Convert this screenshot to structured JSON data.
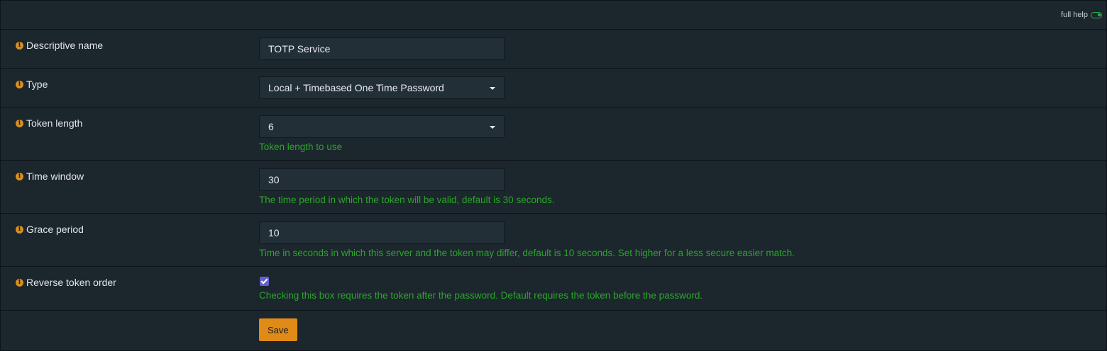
{
  "topbar": {
    "full_help_label": "full help"
  },
  "fields": {
    "descriptive_name": {
      "label": "Descriptive name",
      "value": "TOTP Service"
    },
    "type": {
      "label": "Type",
      "value": "Local + Timebased One Time Password"
    },
    "token_length": {
      "label": "Token length",
      "value": "6",
      "help": "Token length to use"
    },
    "time_window": {
      "label": "Time window",
      "value": "30",
      "help": "The time period in which the token will be valid, default is 30 seconds."
    },
    "grace_period": {
      "label": "Grace period",
      "value": "10",
      "help": "Time in seconds in which this server and the token may differ, default is 10 seconds. Set higher for a less secure easier match."
    },
    "reverse_token_order": {
      "label": "Reverse token order",
      "checked": true,
      "help": "Checking this box requires the token after the password. Default requires the token before the password."
    }
  },
  "actions": {
    "save_label": "Save"
  },
  "colors": {
    "info_icon": "#d98f1e",
    "help_text": "#2ba62b",
    "save_button": "#e08a17",
    "checkbox": "#6a5fd0",
    "toggle_on": "#2bb24a"
  }
}
